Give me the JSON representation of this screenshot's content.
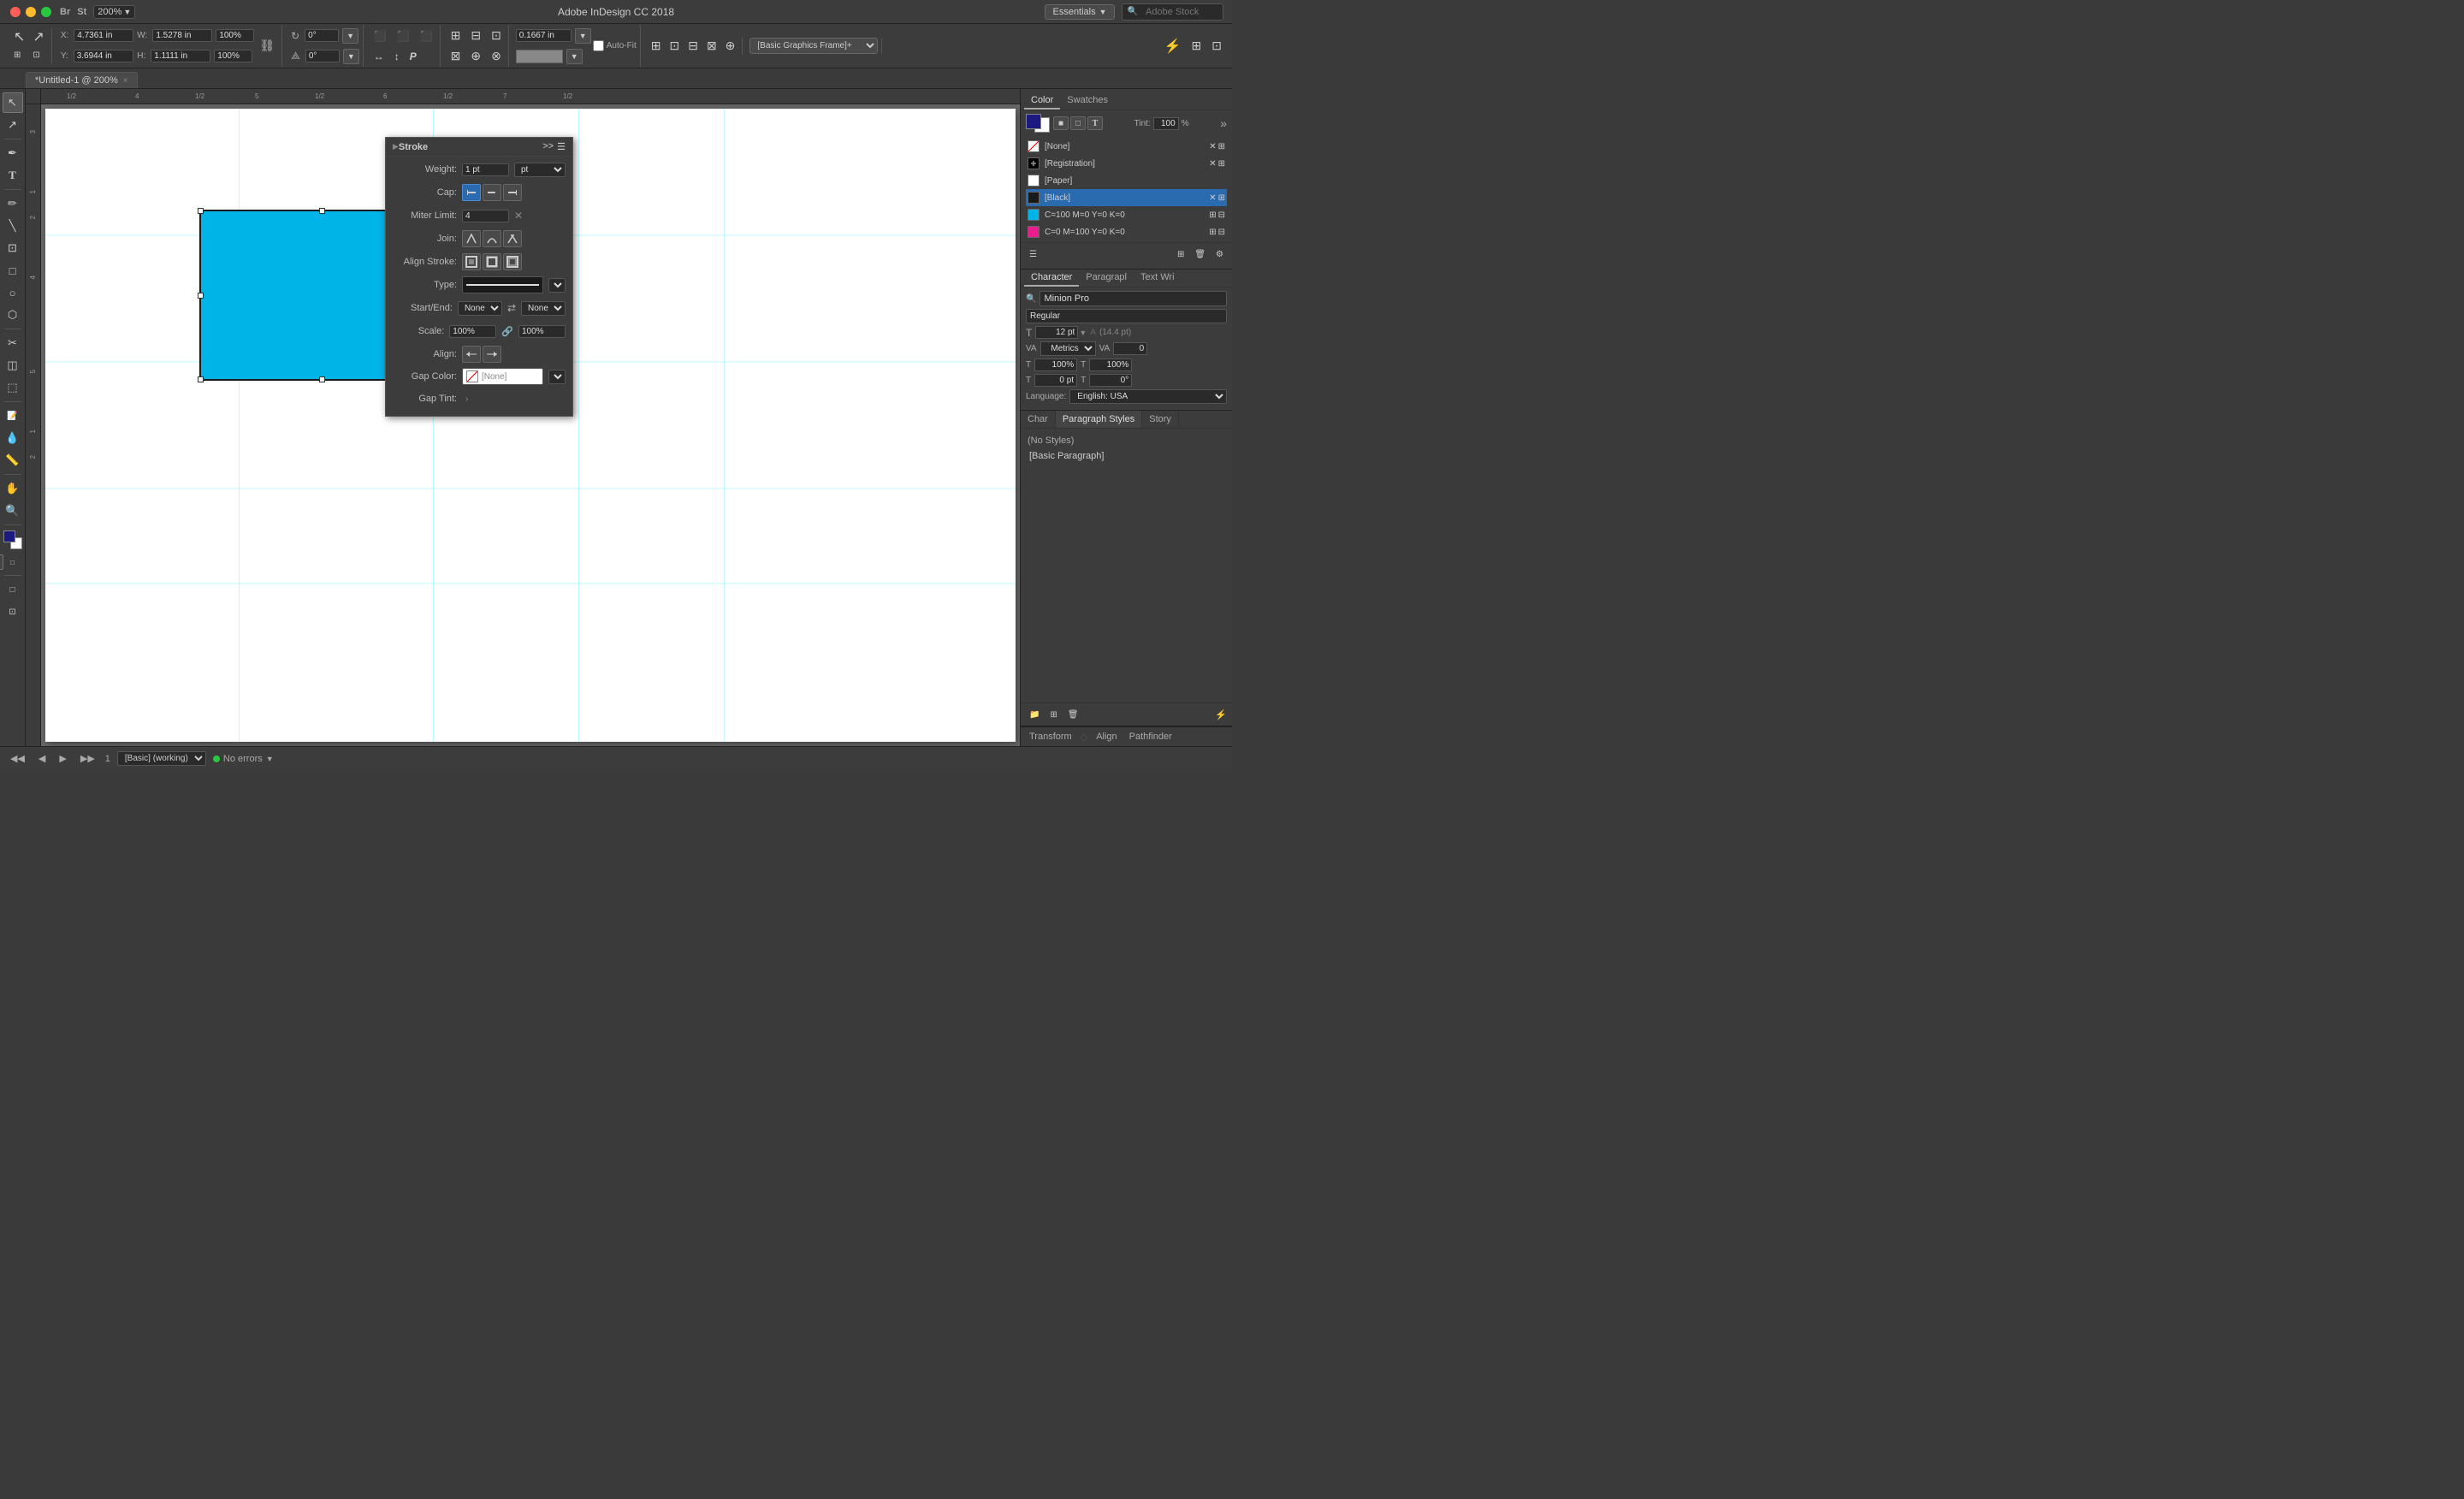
{
  "titlebar": {
    "title": "Adobe InDesign CC 2018",
    "zoom": "200%",
    "essentials": "Essentials",
    "stock_placeholder": "Adobe Stock"
  },
  "toolbar": {
    "x_label": "X:",
    "x_value": "4.7361 in",
    "y_label": "Y:",
    "y_value": "3.6944 in",
    "w_label": "W:",
    "w_value": "1.5278 in",
    "h_label": "H:",
    "h_value": "1.1111 in",
    "w_pct": "100%",
    "h_pct": "100%",
    "rotate_label": "0°",
    "shear_label": "0°",
    "stroke_value": "0.1667 in",
    "auto_fit": "Auto-Fit",
    "frame_type": "[Basic Graphics Frame]+"
  },
  "tab": {
    "label": "*Untitled-1 @ 200%",
    "close": "×"
  },
  "stroke_panel": {
    "title": "Stroke",
    "weight_label": "Weight:",
    "weight_value": "1 pt",
    "cap_label": "Cap:",
    "miter_label": "Miter Limit:",
    "miter_value": "4",
    "join_label": "Join:",
    "align_label": "Align Stroke:",
    "type_label": "Type:",
    "start_end_label": "Start/End:",
    "start_value": "None",
    "end_value": "None",
    "scale_label": "Scale:",
    "scale_value1": "100%",
    "scale_value2": "100%",
    "align_stroke_label": "Align:",
    "gap_color_label": "Gap Color:",
    "gap_color_value": "[None]",
    "gap_tint_label": "Gap Tint:"
  },
  "color_panel": {
    "tab1": "Color",
    "tab2": "Swatches",
    "tint_label": "Tint:",
    "tint_value": "100",
    "swatches": [
      {
        "id": "none",
        "label": "[None]",
        "color": null,
        "type": "none"
      },
      {
        "id": "registration",
        "label": "[Registration]",
        "color": "#000",
        "type": "special"
      },
      {
        "id": "paper",
        "label": "[Paper]",
        "color": "#fff",
        "type": "solid"
      },
      {
        "id": "black",
        "label": "[Black]",
        "color": "#1a1a1a",
        "type": "solid",
        "selected": true
      },
      {
        "id": "cyan",
        "label": "C=100 M=0 Y=0 K=0",
        "color": "#00b4e8",
        "type": "solid"
      },
      {
        "id": "magenta",
        "label": "C=0 M=100 Y=0 K=0",
        "color": "#e91e8c",
        "type": "solid"
      }
    ]
  },
  "character_panel": {
    "title": "Character",
    "tab1": "Paragrapl",
    "tab2": "Text Wri",
    "font": "Minion Pro",
    "style": "Regular",
    "size": "12 pt",
    "auto_size": "(14.4 pt)",
    "tracking_label": "Metrics",
    "tracking_value": "0",
    "scale_h": "100%",
    "scale_v": "100%",
    "baseline": "0 pt",
    "skew": "0°",
    "language": "English: USA"
  },
  "para_panel": {
    "tabs": [
      "Char",
      "Paragraph Styles",
      "Story"
    ],
    "no_styles": "(No Styles)",
    "basic_para": "[Basic Paragraph]"
  },
  "bottom_panel": {
    "tabs": [
      "Transform",
      "Align",
      "Pathfinder"
    ]
  },
  "statusbar": {
    "page": "1",
    "working": "[Basic] (working)",
    "no_errors": "No errors"
  },
  "ruler": {
    "h_marks": [
      "1/2",
      "4",
      "1/2",
      "5",
      "1/2",
      "6",
      "1/2",
      "7",
      "1/2"
    ],
    "v_marks": [
      "3",
      "1",
      "2",
      "4",
      "5",
      "1",
      "2"
    ]
  },
  "canvas": {
    "rect_color": "#00b4e8",
    "rect_border": "#1a1a1a"
  }
}
